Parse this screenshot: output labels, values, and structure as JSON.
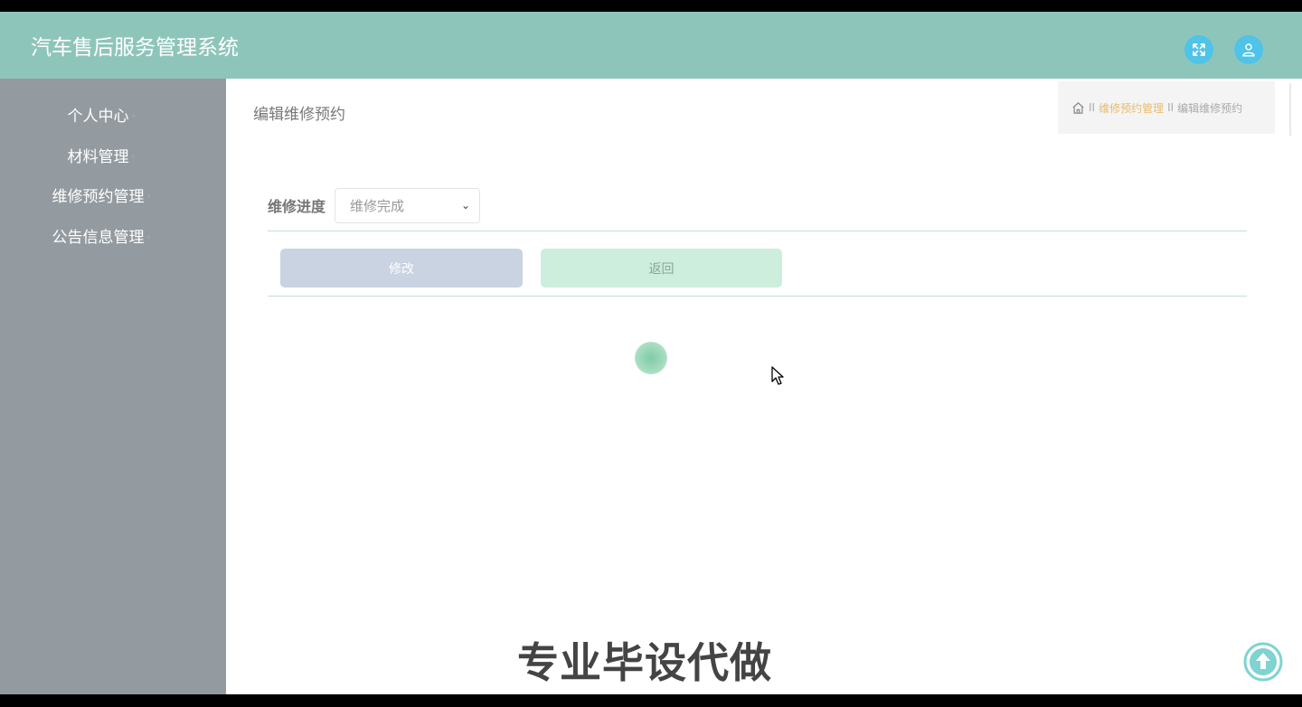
{
  "header": {
    "app_title": "汽车售后服务管理系统",
    "fullscreen_icon": "fullscreen-icon",
    "user_icon": "user-icon",
    "accent_color": "#8ec5bb",
    "icon_color": "#4fc3e8"
  },
  "sidebar": {
    "items": [
      {
        "label": "个人中心"
      },
      {
        "label": "材料管理"
      },
      {
        "label": "维修预约管理"
      },
      {
        "label": "公告信息管理"
      }
    ],
    "background": "#949ba0"
  },
  "main": {
    "page_title": "编辑维修预约",
    "breadcrumb": {
      "separator": "II",
      "link": "维修预约管理",
      "current": "编辑维修预约"
    },
    "form": {
      "progress_label": "维修进度",
      "progress_value": "维修完成"
    },
    "buttons": {
      "edit_label": "修改",
      "back_label": "返回"
    },
    "overlay_text": "专业毕设代做"
  }
}
